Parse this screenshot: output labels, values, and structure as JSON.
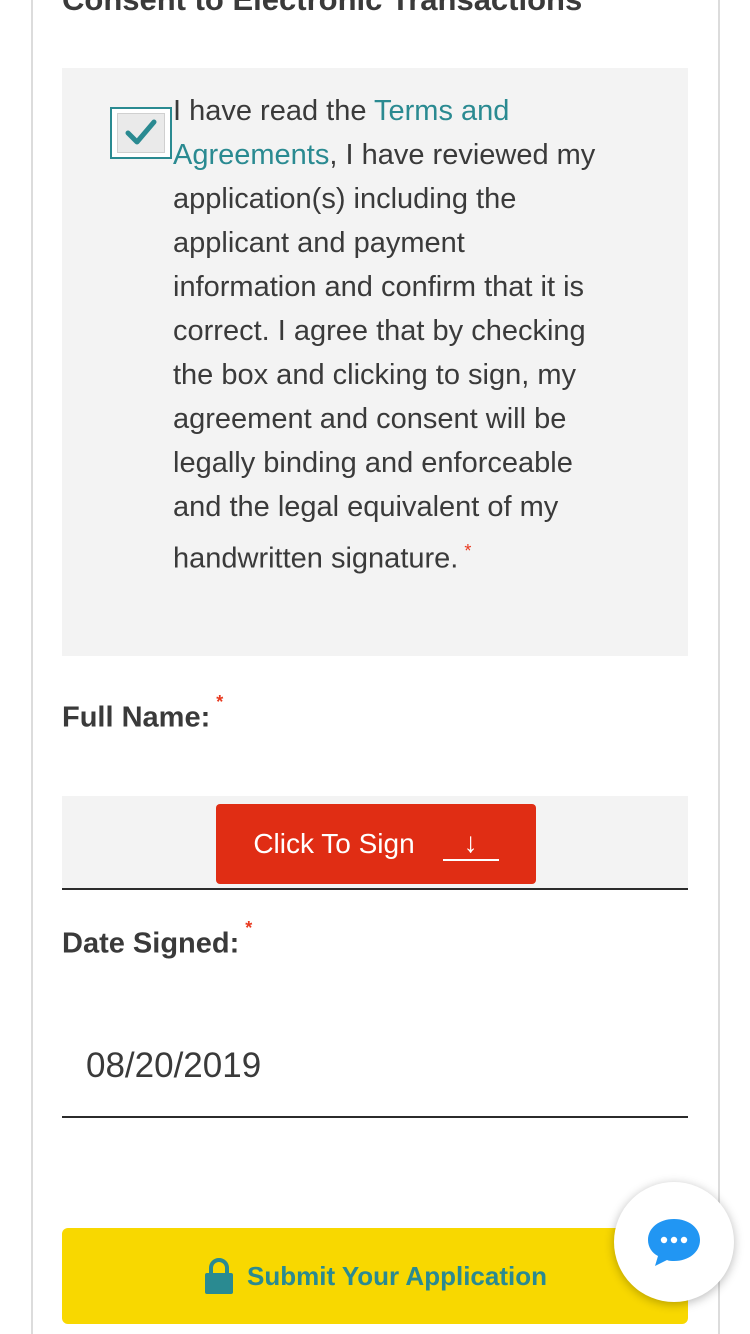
{
  "section": {
    "title": "Consent to Electronic Transactions"
  },
  "consent": {
    "checked": true,
    "text_before": "I have read the ",
    "link_text": "Terms and Agreements",
    "text_after": ", I have reviewed my application(s) including the applicant and payment information and confirm that it is correct. I agree that by checking the box and clicking to sign, my agreement and consent will be legally binding and enforceable and the legal equivalent of my handwritten signature.",
    "required_marker": "*"
  },
  "full_name": {
    "label": "Full Name:",
    "required_marker": "*",
    "sign_button_label": "Click To Sign",
    "sign_button_arrow": "↓"
  },
  "date_signed": {
    "label": "Date Signed:",
    "required_marker": "*",
    "value": "08/20/2019"
  },
  "submit": {
    "label": "Submit Your Application",
    "icon": "lock-icon"
  },
  "chat": {
    "icon": "chat-bubble-icon"
  },
  "colors": {
    "accent_teal": "#2a8a91",
    "required_red": "#e8391f",
    "sign_button_red": "#e02d14",
    "submit_yellow": "#f8d800",
    "chat_blue": "#2196f3"
  }
}
